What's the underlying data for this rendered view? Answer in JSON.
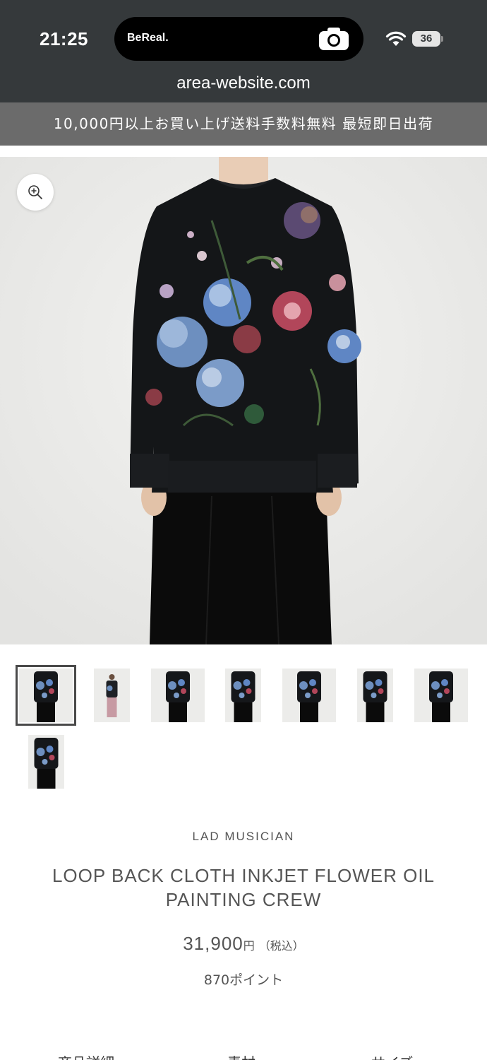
{
  "status_bar": {
    "time": "21:25",
    "island_app": "BeReal.",
    "battery": "36"
  },
  "browser": {
    "url": "area-website.com"
  },
  "banner": {
    "text": "10,000円以上お買い上げ送料手数料無料 最短即日出荷"
  },
  "gallery": {
    "zoom_icon": "zoom-in-icon",
    "thumbnail_count": 8,
    "active_thumbnail": 1
  },
  "product": {
    "brand": "LAD MUSICIAN",
    "title": "LOOP BACK CLOTH INKJET FLOWER OIL PAINTING CREW",
    "price": "31,900",
    "currency": "円",
    "tax_note": "（税込）",
    "points": "870ポイント"
  },
  "tabs": [
    "商品詳細",
    "素材",
    "サイズ"
  ],
  "colors": {
    "chrome": "#35393b",
    "banner": "#6b6b6b",
    "text": "#555555"
  }
}
